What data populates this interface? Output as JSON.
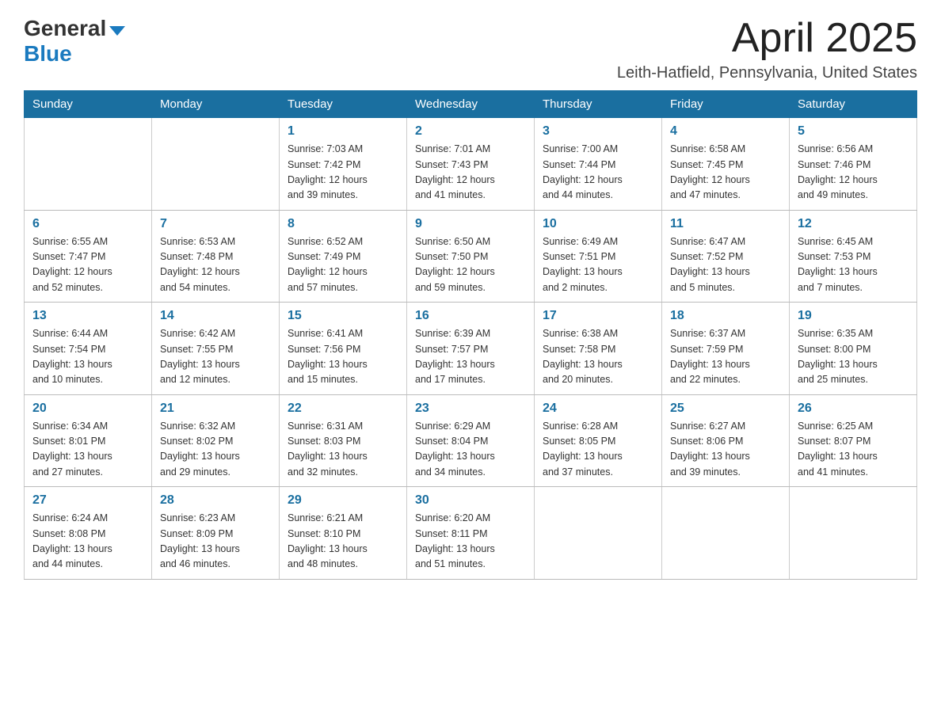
{
  "header": {
    "logo_general": "General",
    "logo_blue": "Blue",
    "month_title": "April 2025",
    "location": "Leith-Hatfield, Pennsylvania, United States"
  },
  "weekdays": [
    "Sunday",
    "Monday",
    "Tuesday",
    "Wednesday",
    "Thursday",
    "Friday",
    "Saturday"
  ],
  "weeks": [
    [
      {
        "day": "",
        "info": ""
      },
      {
        "day": "",
        "info": ""
      },
      {
        "day": "1",
        "info": "Sunrise: 7:03 AM\nSunset: 7:42 PM\nDaylight: 12 hours\nand 39 minutes."
      },
      {
        "day": "2",
        "info": "Sunrise: 7:01 AM\nSunset: 7:43 PM\nDaylight: 12 hours\nand 41 minutes."
      },
      {
        "day": "3",
        "info": "Sunrise: 7:00 AM\nSunset: 7:44 PM\nDaylight: 12 hours\nand 44 minutes."
      },
      {
        "day": "4",
        "info": "Sunrise: 6:58 AM\nSunset: 7:45 PM\nDaylight: 12 hours\nand 47 minutes."
      },
      {
        "day": "5",
        "info": "Sunrise: 6:56 AM\nSunset: 7:46 PM\nDaylight: 12 hours\nand 49 minutes."
      }
    ],
    [
      {
        "day": "6",
        "info": "Sunrise: 6:55 AM\nSunset: 7:47 PM\nDaylight: 12 hours\nand 52 minutes."
      },
      {
        "day": "7",
        "info": "Sunrise: 6:53 AM\nSunset: 7:48 PM\nDaylight: 12 hours\nand 54 minutes."
      },
      {
        "day": "8",
        "info": "Sunrise: 6:52 AM\nSunset: 7:49 PM\nDaylight: 12 hours\nand 57 minutes."
      },
      {
        "day": "9",
        "info": "Sunrise: 6:50 AM\nSunset: 7:50 PM\nDaylight: 12 hours\nand 59 minutes."
      },
      {
        "day": "10",
        "info": "Sunrise: 6:49 AM\nSunset: 7:51 PM\nDaylight: 13 hours\nand 2 minutes."
      },
      {
        "day": "11",
        "info": "Sunrise: 6:47 AM\nSunset: 7:52 PM\nDaylight: 13 hours\nand 5 minutes."
      },
      {
        "day": "12",
        "info": "Sunrise: 6:45 AM\nSunset: 7:53 PM\nDaylight: 13 hours\nand 7 minutes."
      }
    ],
    [
      {
        "day": "13",
        "info": "Sunrise: 6:44 AM\nSunset: 7:54 PM\nDaylight: 13 hours\nand 10 minutes."
      },
      {
        "day": "14",
        "info": "Sunrise: 6:42 AM\nSunset: 7:55 PM\nDaylight: 13 hours\nand 12 minutes."
      },
      {
        "day": "15",
        "info": "Sunrise: 6:41 AM\nSunset: 7:56 PM\nDaylight: 13 hours\nand 15 minutes."
      },
      {
        "day": "16",
        "info": "Sunrise: 6:39 AM\nSunset: 7:57 PM\nDaylight: 13 hours\nand 17 minutes."
      },
      {
        "day": "17",
        "info": "Sunrise: 6:38 AM\nSunset: 7:58 PM\nDaylight: 13 hours\nand 20 minutes."
      },
      {
        "day": "18",
        "info": "Sunrise: 6:37 AM\nSunset: 7:59 PM\nDaylight: 13 hours\nand 22 minutes."
      },
      {
        "day": "19",
        "info": "Sunrise: 6:35 AM\nSunset: 8:00 PM\nDaylight: 13 hours\nand 25 minutes."
      }
    ],
    [
      {
        "day": "20",
        "info": "Sunrise: 6:34 AM\nSunset: 8:01 PM\nDaylight: 13 hours\nand 27 minutes."
      },
      {
        "day": "21",
        "info": "Sunrise: 6:32 AM\nSunset: 8:02 PM\nDaylight: 13 hours\nand 29 minutes."
      },
      {
        "day": "22",
        "info": "Sunrise: 6:31 AM\nSunset: 8:03 PM\nDaylight: 13 hours\nand 32 minutes."
      },
      {
        "day": "23",
        "info": "Sunrise: 6:29 AM\nSunset: 8:04 PM\nDaylight: 13 hours\nand 34 minutes."
      },
      {
        "day": "24",
        "info": "Sunrise: 6:28 AM\nSunset: 8:05 PM\nDaylight: 13 hours\nand 37 minutes."
      },
      {
        "day": "25",
        "info": "Sunrise: 6:27 AM\nSunset: 8:06 PM\nDaylight: 13 hours\nand 39 minutes."
      },
      {
        "day": "26",
        "info": "Sunrise: 6:25 AM\nSunset: 8:07 PM\nDaylight: 13 hours\nand 41 minutes."
      }
    ],
    [
      {
        "day": "27",
        "info": "Sunrise: 6:24 AM\nSunset: 8:08 PM\nDaylight: 13 hours\nand 44 minutes."
      },
      {
        "day": "28",
        "info": "Sunrise: 6:23 AM\nSunset: 8:09 PM\nDaylight: 13 hours\nand 46 minutes."
      },
      {
        "day": "29",
        "info": "Sunrise: 6:21 AM\nSunset: 8:10 PM\nDaylight: 13 hours\nand 48 minutes."
      },
      {
        "day": "30",
        "info": "Sunrise: 6:20 AM\nSunset: 8:11 PM\nDaylight: 13 hours\nand 51 minutes."
      },
      {
        "day": "",
        "info": ""
      },
      {
        "day": "",
        "info": ""
      },
      {
        "day": "",
        "info": ""
      }
    ]
  ]
}
